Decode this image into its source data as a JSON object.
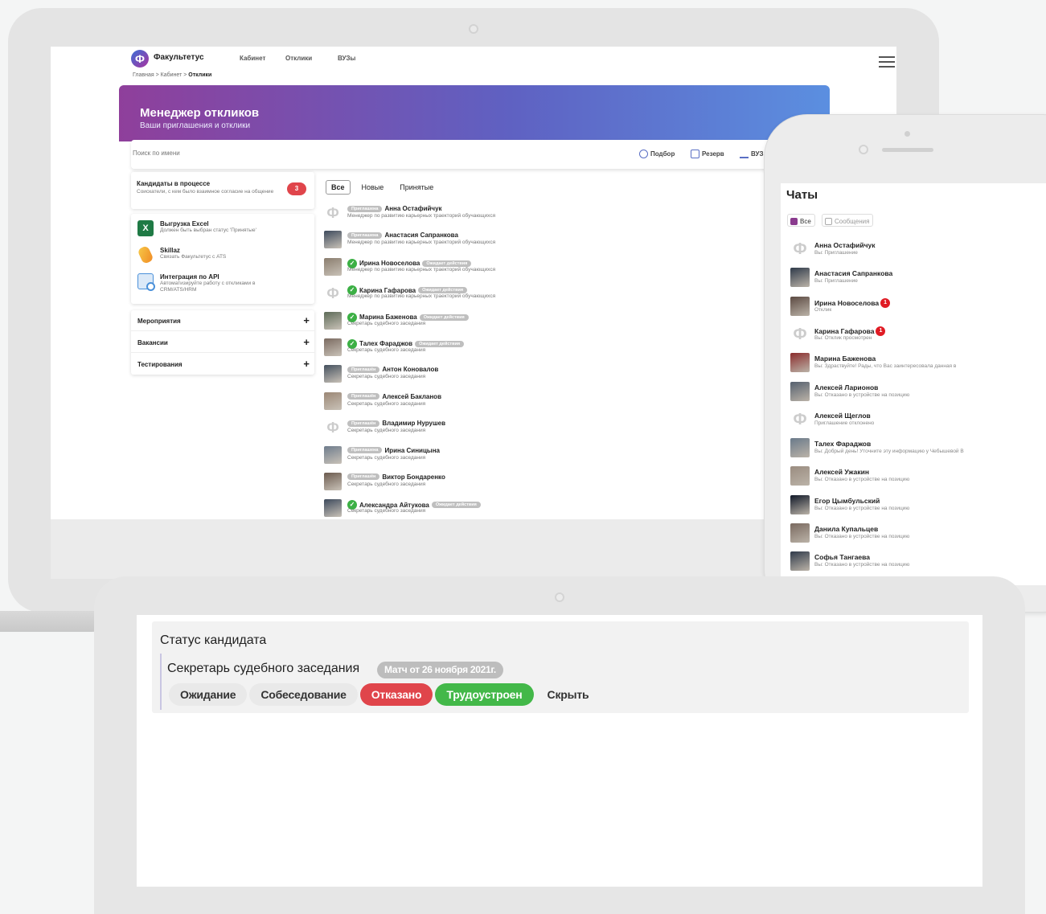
{
  "laptop": {
    "app": {
      "logo_letter": "Ф",
      "name": "Факультетус",
      "nav": [
        "Кабинет",
        "Отклики",
        "ВУЗы"
      ]
    },
    "breadcrumb": {
      "part1": "Главная",
      "sep": ">",
      "part2": "Кабинет",
      "current": "Отклики"
    },
    "banner": {
      "title": "Менеджер откликов",
      "subtitle": "Ваши приглашения и отклики"
    },
    "search": {
      "placeholder": "Поиск по имени"
    },
    "actions": [
      "Подбор",
      "Резерв",
      "ВУЗ"
    ],
    "candidates": {
      "title": "Кандидаты в процессе",
      "desc": "Соискатели, с кем было взаимное согласие на общение",
      "count": "3"
    },
    "integrations": [
      {
        "icon": "excel-icon",
        "title": "Выгрузка Excel",
        "desc": "Должен быть выбран статус 'Принятые'",
        "color": "#1f7a45"
      },
      {
        "icon": "skillaz-icon",
        "title": "Skillaz",
        "desc": "Связать Факультетус с ATS",
        "color": "#f5a623"
      },
      {
        "icon": "api-icon",
        "title": "Интеграция по API",
        "desc": "Автоматизируйте работу с откликами в CRM/ATS/HRM",
        "color": "#4a90d9"
      }
    ],
    "accordion": [
      "Мероприятия",
      "Вакансии",
      "Тестирования"
    ],
    "tabs": [
      "Все",
      "Новые",
      "Принятые"
    ],
    "responses": [
      {
        "avatar": "placeholder",
        "pre": "Приглашена",
        "name": "Анна Остафийчук",
        "post": "",
        "role": "Менеджер по развитию карьерных траекторий обучающихся"
      },
      {
        "avatar": "photo",
        "pre": "Приглашена",
        "name": "Анастасия Сапранкова",
        "post": "",
        "role": "Менеджер по развитию карьерных траекторий обучающихся"
      },
      {
        "avatar": "photo",
        "pre": "check",
        "name": "Ирина Новоселова",
        "post": "Ожидает действия",
        "role": "Менеджер по развитию карьерных траекторий обучающихся"
      },
      {
        "avatar": "placeholder",
        "pre": "check",
        "name": "Карина Гафарова",
        "post": "Ожидает действия",
        "role": "Менеджер по развитию карьерных траекторий обучающихся"
      },
      {
        "avatar": "photo",
        "pre": "check",
        "name": "Марина Баженова",
        "post": "Ожидает действия",
        "role": "Секретарь судебного заседания"
      },
      {
        "avatar": "photo",
        "pre": "check",
        "name": "Талех Фараджов",
        "post": "Ожидает действия",
        "role": "Секретарь судебного заседания"
      },
      {
        "avatar": "photo",
        "pre": "Приглашён",
        "name": "Антон Коновалов",
        "post": "",
        "role": "Секретарь судебного заседания"
      },
      {
        "avatar": "photo",
        "pre": "Приглашён",
        "name": "Алексей Бакланов",
        "post": "",
        "role": "Секретарь судебного заседания"
      },
      {
        "avatar": "placeholder",
        "pre": "Приглашён",
        "name": "Владимир Нурушев",
        "post": "",
        "role": "Секретарь судебного заседания"
      },
      {
        "avatar": "photo",
        "pre": "Приглашена",
        "name": "Ирина Синицына",
        "post": "",
        "role": "Секретарь судебного заседания"
      },
      {
        "avatar": "photo",
        "pre": "Приглашён",
        "name": "Виктор Бондаренко",
        "post": "",
        "role": "Секретарь судебного заседания"
      },
      {
        "avatar": "photo",
        "pre": "check",
        "name": "Александра Айтукова",
        "post": "Ожидает действия",
        "role": "Секретарь судебного заседания"
      }
    ]
  },
  "phone": {
    "title": "Чаты",
    "filters": [
      "Все",
      "Сообщения"
    ],
    "chats": [
      {
        "avatar": "placeholder",
        "name": "Анна Остафийчук",
        "unread": "",
        "msg": "Вы: Приглашение"
      },
      {
        "avatar": "photo",
        "name": "Анастасия Сапранкова",
        "unread": "",
        "msg": "Вы: Приглашение"
      },
      {
        "avatar": "photo",
        "name": "Ирина Новоселова",
        "unread": "1",
        "msg": "Отклик"
      },
      {
        "avatar": "placeholder",
        "name": "Карина Гафарова",
        "unread": "1",
        "msg": "Вы: Отклик просмотрен"
      },
      {
        "avatar": "photo",
        "name": "Марина Баженова",
        "unread": "",
        "msg": "Вы: Здраствуйте! Рады, что Вас заинтересовала данная в"
      },
      {
        "avatar": "photo",
        "name": "Алексей Ларионов",
        "unread": "",
        "msg": "Вы: Отказано в устройстве на позицию"
      },
      {
        "avatar": "placeholder",
        "name": "Алексей Щеглов",
        "unread": "",
        "msg": "Приглашение отклонено"
      },
      {
        "avatar": "photo",
        "name": "Талех Фараджов",
        "unread": "",
        "msg": "Вы: Добрый день! Уточните эту информацию у Чебышевой В"
      },
      {
        "avatar": "photo",
        "name": "Алексей Ужакин",
        "unread": "",
        "msg": "Вы: Отказано в устройстве на позицию"
      },
      {
        "avatar": "photo",
        "name": "Егор Цымбульский",
        "unread": "",
        "msg": "Вы: Отказано в устройстве на позицию"
      },
      {
        "avatar": "photo",
        "name": "Данила Купальцев",
        "unread": "",
        "msg": "Вы: Отказано в устройстве на позицию"
      },
      {
        "avatar": "photo",
        "name": "Софья Тангаева",
        "unread": "",
        "msg": "Вы: Отказано в устройстве на позицию"
      }
    ]
  },
  "tablet": {
    "title": "Статус кандидата",
    "vacancy": "Секретарь судебного заседания",
    "match": "Матч от 26 ноября 2021г.",
    "buttons": [
      "Ожидание",
      "Собеседование",
      "Отказано",
      "Трудоустроен",
      "Скрыть"
    ]
  },
  "colors": {
    "accent_purple": "#8f3f9b",
    "accent_blue": "#5b8fe0",
    "danger": "#e0454b",
    "success": "#43b849"
  }
}
